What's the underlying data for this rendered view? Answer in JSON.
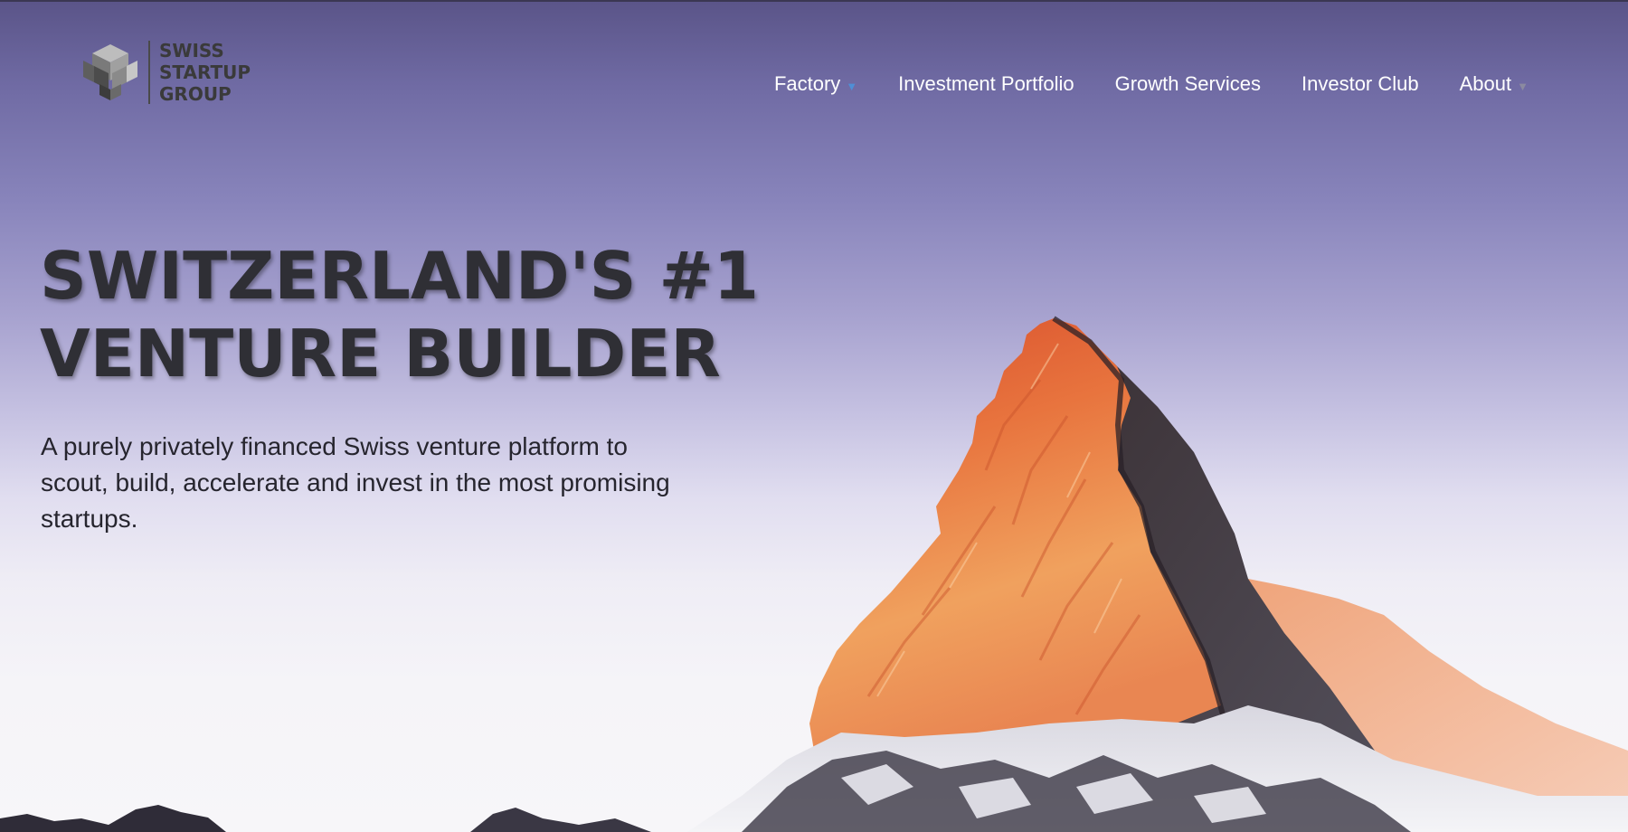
{
  "logo": {
    "lines": [
      "SWISS",
      "STARTUP",
      "GROUP"
    ]
  },
  "nav": {
    "items": [
      {
        "label": "Factory",
        "dropdown": true,
        "caret_color": "#4f8fd6"
      },
      {
        "label": "Investment Portfolio",
        "dropdown": false
      },
      {
        "label": "Growth Services",
        "dropdown": false
      },
      {
        "label": "Investor Club",
        "dropdown": false
      },
      {
        "label": "About",
        "dropdown": true,
        "caret_color": "#8b8aa0"
      }
    ]
  },
  "hero": {
    "headline_line1": "SWITZERLAND'S #1",
    "headline_line2": "VENTURE BUILDER",
    "subtext": "A purely privately financed Swiss venture platform to scout, build, accelerate and invest in the most promising startups."
  },
  "colors": {
    "sky_top": "#5a5488",
    "sky_bottom": "#f7f6f9",
    "headline": "#2f2f35",
    "mountain_lit": "#e0703c",
    "nav_text": "#ffffff"
  }
}
